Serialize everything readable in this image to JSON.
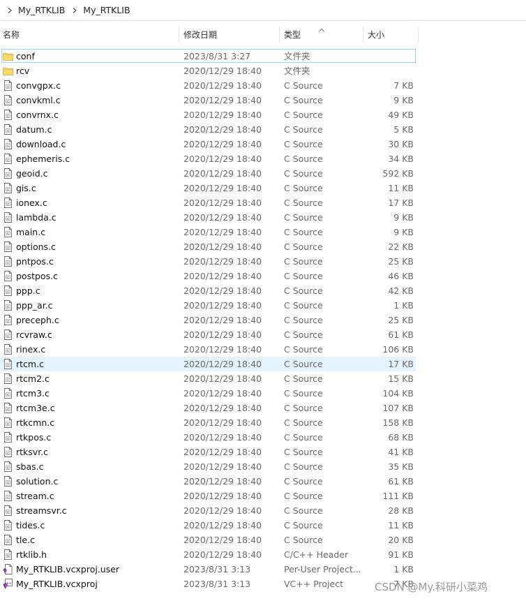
{
  "breadcrumb": [
    "My_RTKLIB",
    "My_RTKLIB"
  ],
  "columns": {
    "name": "名称",
    "date": "修改日期",
    "type": "类型",
    "size": "大小"
  },
  "files": [
    {
      "name": "conf",
      "date": "2023/8/31 3:27",
      "type": "文件夹",
      "size": "",
      "icon": "folder-icon"
    },
    {
      "name": "rcv",
      "date": "2020/12/29 18:40",
      "type": "文件夹",
      "size": "",
      "icon": "folder-icon"
    },
    {
      "name": "convgpx.c",
      "date": "2020/12/29 18:40",
      "type": "C Source",
      "size": "7 KB",
      "icon": "c-file-icon"
    },
    {
      "name": "convkml.c",
      "date": "2020/12/29 18:40",
      "type": "C Source",
      "size": "9 KB",
      "icon": "c-file-icon"
    },
    {
      "name": "convrnx.c",
      "date": "2020/12/29 18:40",
      "type": "C Source",
      "size": "49 KB",
      "icon": "c-file-icon"
    },
    {
      "name": "datum.c",
      "date": "2020/12/29 18:40",
      "type": "C Source",
      "size": "5 KB",
      "icon": "c-file-icon"
    },
    {
      "name": "download.c",
      "date": "2020/12/29 18:40",
      "type": "C Source",
      "size": "30 KB",
      "icon": "c-file-icon"
    },
    {
      "name": "ephemeris.c",
      "date": "2020/12/29 18:40",
      "type": "C Source",
      "size": "34 KB",
      "icon": "c-file-icon"
    },
    {
      "name": "geoid.c",
      "date": "2020/12/29 18:40",
      "type": "C Source",
      "size": "592 KB",
      "icon": "c-file-icon"
    },
    {
      "name": "gis.c",
      "date": "2020/12/29 18:40",
      "type": "C Source",
      "size": "11 KB",
      "icon": "c-file-icon"
    },
    {
      "name": "ionex.c",
      "date": "2020/12/29 18:40",
      "type": "C Source",
      "size": "17 KB",
      "icon": "c-file-icon"
    },
    {
      "name": "lambda.c",
      "date": "2020/12/29 18:40",
      "type": "C Source",
      "size": "9 KB",
      "icon": "c-file-icon"
    },
    {
      "name": "main.c",
      "date": "2020/12/29 18:40",
      "type": "C Source",
      "size": "9 KB",
      "icon": "c-file-icon"
    },
    {
      "name": "options.c",
      "date": "2020/12/29 18:40",
      "type": "C Source",
      "size": "22 KB",
      "icon": "c-file-icon"
    },
    {
      "name": "pntpos.c",
      "date": "2020/12/29 18:40",
      "type": "C Source",
      "size": "25 KB",
      "icon": "c-file-icon"
    },
    {
      "name": "postpos.c",
      "date": "2020/12/29 18:40",
      "type": "C Source",
      "size": "46 KB",
      "icon": "c-file-icon"
    },
    {
      "name": "ppp.c",
      "date": "2020/12/29 18:40",
      "type": "C Source",
      "size": "42 KB",
      "icon": "c-file-icon"
    },
    {
      "name": "ppp_ar.c",
      "date": "2020/12/29 18:40",
      "type": "C Source",
      "size": "1 KB",
      "icon": "c-file-icon"
    },
    {
      "name": "preceph.c",
      "date": "2020/12/29 18:40",
      "type": "C Source",
      "size": "25 KB",
      "icon": "c-file-icon"
    },
    {
      "name": "rcvraw.c",
      "date": "2020/12/29 18:40",
      "type": "C Source",
      "size": "61 KB",
      "icon": "c-file-icon"
    },
    {
      "name": "rinex.c",
      "date": "2020/12/29 18:40",
      "type": "C Source",
      "size": "106 KB",
      "icon": "c-file-icon"
    },
    {
      "name": "rtcm.c",
      "date": "2020/12/29 18:40",
      "type": "C Source",
      "size": "17 KB",
      "icon": "c-file-icon"
    },
    {
      "name": "rtcm2.c",
      "date": "2020/12/29 18:40",
      "type": "C Source",
      "size": "15 KB",
      "icon": "c-file-icon"
    },
    {
      "name": "rtcm3.c",
      "date": "2020/12/29 18:40",
      "type": "C Source",
      "size": "104 KB",
      "icon": "c-file-icon"
    },
    {
      "name": "rtcm3e.c",
      "date": "2020/12/29 18:40",
      "type": "C Source",
      "size": "107 KB",
      "icon": "c-file-icon"
    },
    {
      "name": "rtkcmn.c",
      "date": "2020/12/29 18:40",
      "type": "C Source",
      "size": "158 KB",
      "icon": "c-file-icon"
    },
    {
      "name": "rtkpos.c",
      "date": "2020/12/29 18:40",
      "type": "C Source",
      "size": "68 KB",
      "icon": "c-file-icon"
    },
    {
      "name": "rtksvr.c",
      "date": "2020/12/29 18:40",
      "type": "C Source",
      "size": "41 KB",
      "icon": "c-file-icon"
    },
    {
      "name": "sbas.c",
      "date": "2020/12/29 18:40",
      "type": "C Source",
      "size": "35 KB",
      "icon": "c-file-icon"
    },
    {
      "name": "solution.c",
      "date": "2020/12/29 18:40",
      "type": "C Source",
      "size": "61 KB",
      "icon": "c-file-icon"
    },
    {
      "name": "stream.c",
      "date": "2020/12/29 18:40",
      "type": "C Source",
      "size": "111 KB",
      "icon": "c-file-icon"
    },
    {
      "name": "streamsvr.c",
      "date": "2020/12/29 18:40",
      "type": "C Source",
      "size": "28 KB",
      "icon": "c-file-icon"
    },
    {
      "name": "tides.c",
      "date": "2020/12/29 18:40",
      "type": "C Source",
      "size": "11 KB",
      "icon": "c-file-icon"
    },
    {
      "name": "tle.c",
      "date": "2020/12/29 18:40",
      "type": "C Source",
      "size": "20 KB",
      "icon": "c-file-icon"
    },
    {
      "name": "rtklib.h",
      "date": "2020/12/29 18:40",
      "type": "C/C++ Header",
      "size": "91 KB",
      "icon": "h-file-icon"
    },
    {
      "name": "My_RTKLIB.vcxproj.user",
      "date": "2023/8/31 3:13",
      "type": "Per-User Project...",
      "size": "1 KB",
      "icon": "vs-user-file-icon"
    },
    {
      "name": "My_RTKLIB.vcxproj",
      "date": "2023/8/31 3:13",
      "type": "VC++ Project",
      "size": "7 KB",
      "icon": "vs-project-icon"
    }
  ],
  "selected_index": 0,
  "hover_index": 21,
  "watermark": "CSDN @My.科研小菜鸡",
  "colors": {
    "folder": "#f8d775",
    "selection_border": "#99d1ff",
    "hover": "#e5f3ff",
    "vs_purple": "#68217a"
  }
}
